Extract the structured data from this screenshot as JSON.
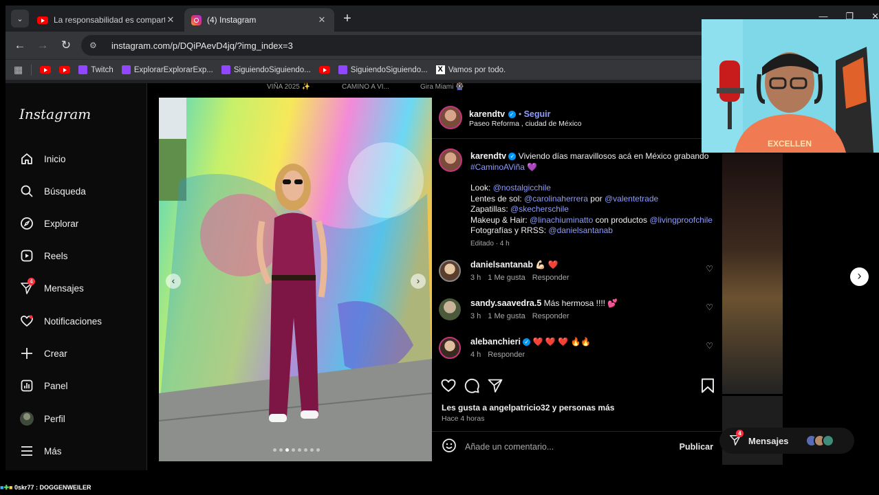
{
  "browser": {
    "tabs": [
      {
        "title": "La responsabilidad es comparti",
        "icon": "youtube-icon"
      },
      {
        "title": "(4) Instagram",
        "icon": "instagram-icon"
      }
    ],
    "url": "instagram.com/p/DQiPAevD4jq/?img_index=3",
    "bookmarks": [
      {
        "label": "",
        "icon": "youtube-icon"
      },
      {
        "label": "",
        "icon": "youtube-icon"
      },
      {
        "label": "Twitch",
        "icon": "twitch-icon"
      },
      {
        "label": "ExplorarExplorarExp...",
        "icon": "twitch-icon"
      },
      {
        "label": "SiguiendoSiguiendo...",
        "icon": "twitch-icon"
      },
      {
        "label": "",
        "icon": "youtube-icon"
      },
      {
        "label": "SiguiendoSiguiendo...",
        "icon": "twitch-icon"
      },
      {
        "label": "Vamos por todo.",
        "icon": "x-icon"
      }
    ]
  },
  "background_highlights": [
    "VIÑA 2025 ✨",
    "CAMINO A VI...",
    "Gira Miami 🎡"
  ],
  "sidebar": {
    "logo": "Instagram",
    "items": [
      {
        "label": "Inicio",
        "icon": "home-icon"
      },
      {
        "label": "Búsqueda",
        "icon": "search-icon"
      },
      {
        "label": "Explorar",
        "icon": "compass-icon"
      },
      {
        "label": "Reels",
        "icon": "reels-icon"
      },
      {
        "label": "Mensajes",
        "icon": "send-icon",
        "badge": "4"
      },
      {
        "label": "Notificaciones",
        "icon": "heart-icon"
      },
      {
        "label": "Crear",
        "icon": "plus-icon"
      },
      {
        "label": "Panel",
        "icon": "chart-icon"
      },
      {
        "label": "Perfil",
        "icon": "avatar-icon"
      },
      {
        "label": "Más",
        "icon": "menu-icon"
      }
    ]
  },
  "post": {
    "author": "karendtv",
    "follow": "Seguir",
    "location": "Paseo Reforma , ciudad de México",
    "caption": {
      "user": "karendtv",
      "text": "Viviendo días maravillosos acá en México grabando",
      "hashtag": "#CaminoAViña",
      "emoji": "💜",
      "lines": [
        {
          "label": "Look:",
          "parts": [
            {
              "t": "@nostalgicchile",
              "link": true
            }
          ]
        },
        {
          "label": "Lentes de sol:",
          "parts": [
            {
              "t": "@carolinaherrera",
              "link": true
            },
            {
              "t": " por ",
              "link": false
            },
            {
              "t": "@valentetrade",
              "link": true
            }
          ]
        },
        {
          "label": "Zapatillas:",
          "parts": [
            {
              "t": "@skecherschile",
              "link": true
            }
          ]
        },
        {
          "label": "Makeup & Hair:",
          "parts": [
            {
              "t": "@linachiuminatto",
              "link": true
            },
            {
              "t": " con productos ",
              "link": false
            },
            {
              "t": "@livingproofchile",
              "link": true
            }
          ]
        },
        {
          "label": "Fotografías y RRSS:",
          "parts": [
            {
              "t": "@danielsantanab",
              "link": true
            }
          ]
        }
      ],
      "edited": "Editado · 4 h"
    },
    "comments": [
      {
        "user": "danielsantanab",
        "text": "💪🏻 ❤️",
        "time": "3 h",
        "likes": "1 Me gusta",
        "reply": "Responder"
      },
      {
        "user": "sandy.saavedra.5",
        "text": "Más hermosa !!!! 💕",
        "time": "3 h",
        "likes": "1 Me gusta",
        "reply": "Responder"
      },
      {
        "user": "alebanchieri",
        "text": "❤️ ❤️ ❤️ 🔥🔥",
        "time": "4 h",
        "likes": "",
        "reply": "Responder",
        "verified": true
      }
    ],
    "likes_text": "Les gusta a angelpatricio32 y personas más",
    "posted_ago": "Hace 4 horas",
    "comment_placeholder": "Añade un comentario...",
    "publish": "Publicar",
    "carousel_dots": 8,
    "carousel_active": 3
  },
  "messages_pill": {
    "label": "Mensajes",
    "badge": "4"
  },
  "stream_footer": "0skr77 : DOGGENWEILER"
}
